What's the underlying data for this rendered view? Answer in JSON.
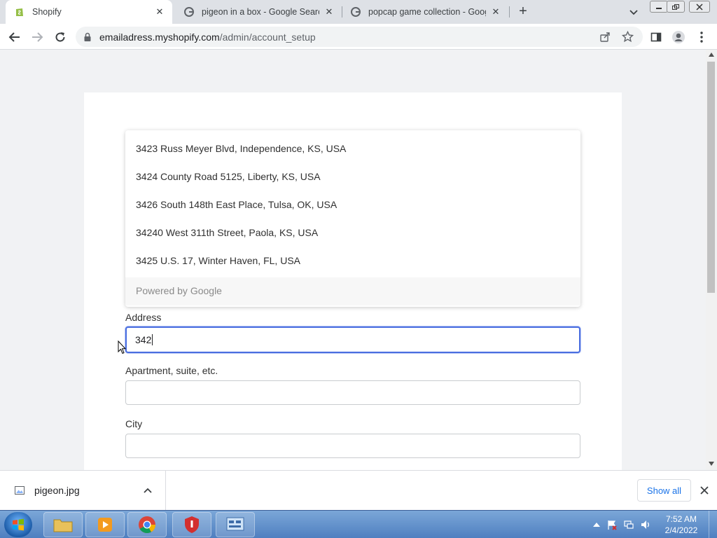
{
  "browser": {
    "tabs": [
      {
        "title": "Shopify",
        "favicon": "shopify-icon",
        "active": true
      },
      {
        "title": "pigeon in a box - Google Search",
        "favicon": "google-icon",
        "active": false
      },
      {
        "title": "popcap game collection - Google",
        "favicon": "google-icon",
        "active": false
      }
    ],
    "url_host": "emailadress.myshopify.com",
    "url_path": "/admin/account_setup"
  },
  "form": {
    "suggestions": [
      "3423 Russ Meyer Blvd, Independence, KS, USA",
      "3424 County Road 5125, Liberty, KS, USA",
      "3426 South 148th East Place, Tulsa, OK, USA",
      "34240 West 311th Street, Paola, KS, USA",
      "3425 U.S. 17, Winter Haven, FL, USA"
    ],
    "powered_by": "Powered by Google",
    "address_label": "Address",
    "address_value": "342",
    "apartment_label": "Apartment, suite, etc.",
    "apartment_value": "",
    "city_label": "City",
    "city_value": ""
  },
  "downloads": {
    "file_name": "pigeon.jpg",
    "show_all_label": "Show all"
  },
  "taskbar": {
    "time": "7:52 AM",
    "date": "2/4/2022"
  },
  "colors": {
    "focus_border": "#4a6ee0",
    "link": "#1a73e8",
    "page_background": "#f1f2f4"
  }
}
